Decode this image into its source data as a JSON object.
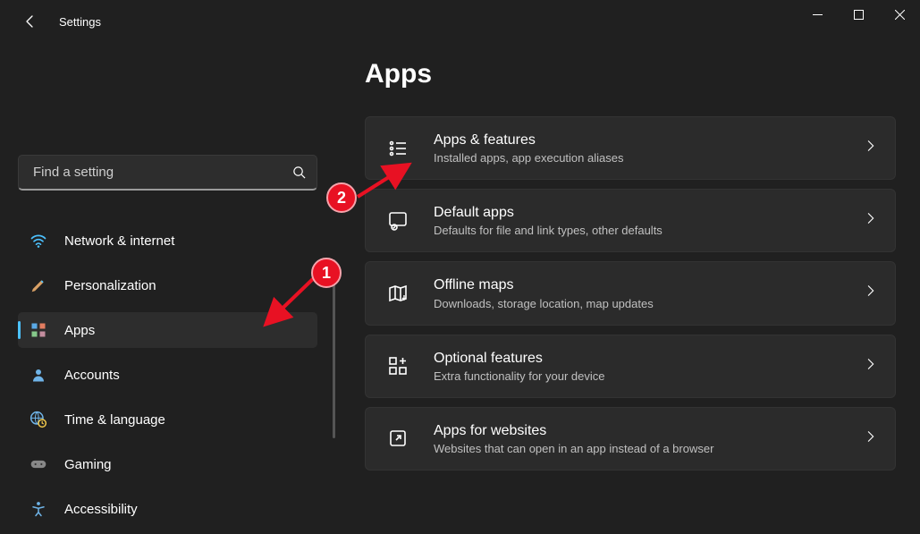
{
  "window": {
    "title": "Settings"
  },
  "search": {
    "placeholder": "Find a setting"
  },
  "sidebar": {
    "items": [
      {
        "label": "Network & internet",
        "icon": "wifi",
        "active": false
      },
      {
        "label": "Personalization",
        "icon": "paintbrush",
        "active": false
      },
      {
        "label": "Apps",
        "icon": "apps",
        "active": true
      },
      {
        "label": "Accounts",
        "icon": "person",
        "active": false
      },
      {
        "label": "Time & language",
        "icon": "globe-clock",
        "active": false
      },
      {
        "label": "Gaming",
        "icon": "gamepad",
        "active": false
      },
      {
        "label": "Accessibility",
        "icon": "accessibility",
        "active": false
      }
    ]
  },
  "page": {
    "title": "Apps"
  },
  "cards": [
    {
      "title": "Apps & features",
      "sub": "Installed apps, app execution aliases",
      "icon": "list"
    },
    {
      "title": "Default apps",
      "sub": "Defaults for file and link types, other defaults",
      "icon": "default-browser"
    },
    {
      "title": "Offline maps",
      "sub": "Downloads, storage location, map updates",
      "icon": "map"
    },
    {
      "title": "Optional features",
      "sub": "Extra functionality for your device",
      "icon": "grid-plus"
    },
    {
      "title": "Apps for websites",
      "sub": "Websites that can open in an app instead of a browser",
      "icon": "launch"
    }
  ],
  "annotations": {
    "step1": "1",
    "step2": "2"
  }
}
